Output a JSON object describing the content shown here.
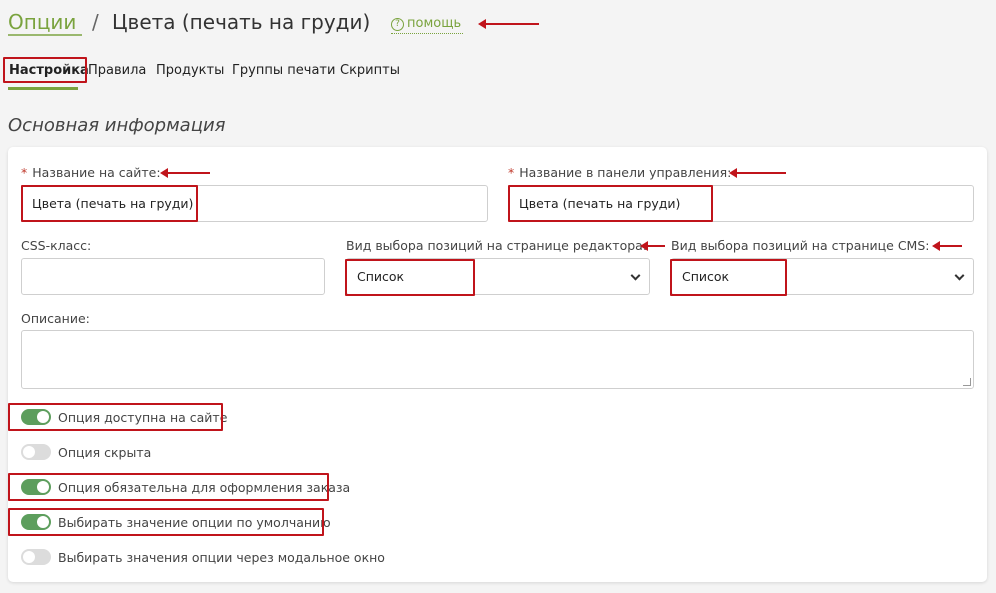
{
  "header": {
    "breadcrumb_root": "Опции",
    "separator": "/",
    "title": "Цвета (печать на груди)",
    "help_icon": "question-circle-icon",
    "help_label": "помощь"
  },
  "tabs": [
    {
      "label": "Настройка",
      "active": true
    },
    {
      "label": "Правила",
      "active": false
    },
    {
      "label": "Продукты",
      "active": false
    },
    {
      "label": "Группы печати",
      "active": false
    },
    {
      "label": "Скрипты",
      "active": false
    }
  ],
  "section_title": "Основная информация",
  "form": {
    "required_mark": "*",
    "site_name_label": "Название на сайте:",
    "site_name_value": "Цвета (печать на груди)",
    "admin_name_label": "Название в панели управления:",
    "admin_name_value": "Цвета (печать на груди)",
    "css_label": "CSS-класс:",
    "css_value": "",
    "editor_view_label": "Вид выбора позиций на странице редактора:",
    "editor_view_value": "Список",
    "cms_view_label": "Вид выбора позиций на странице CMS:",
    "cms_view_value": "Список",
    "description_label": "Описание:",
    "description_value": ""
  },
  "toggles": [
    {
      "label": "Опция доступна на сайте",
      "on": true
    },
    {
      "label": "Опция скрыта",
      "on": false
    },
    {
      "label": "Опция обязательна для оформления заказа",
      "on": true
    },
    {
      "label": "Выбирать значение опции по умолчанию",
      "on": true
    },
    {
      "label": "Выбирать значения опции через модальное окно",
      "on": false
    }
  ],
  "colors": {
    "accent": "#7aa33e",
    "toggle_on": "#5d9e5d",
    "toggle_off": "#dcdcdc",
    "annotation": "#c0141b"
  }
}
